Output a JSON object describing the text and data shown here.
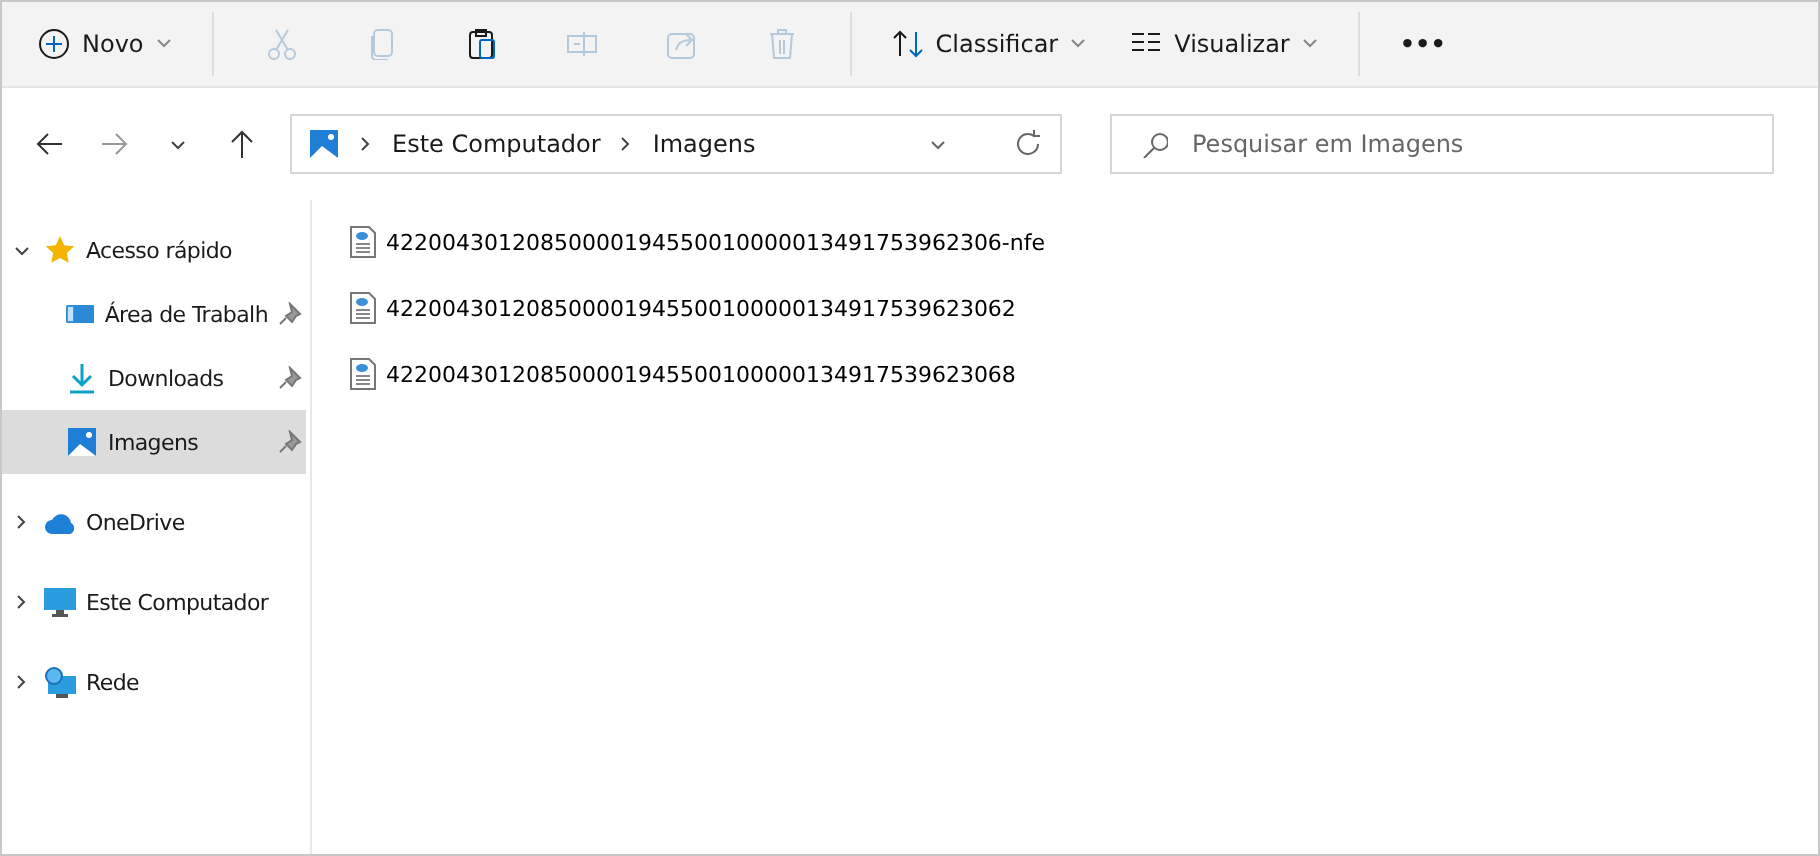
{
  "toolbar": {
    "new": {
      "label": "Novo"
    },
    "actions": [
      {
        "kind": "cut",
        "disabled": true
      },
      {
        "kind": "copy",
        "disabled": true
      },
      {
        "kind": "paste",
        "disabled": false
      },
      {
        "kind": "rename",
        "disabled": true
      },
      {
        "kind": "share",
        "disabled": true
      },
      {
        "kind": "delete",
        "disabled": true
      }
    ],
    "sort": {
      "label": "Classificar"
    },
    "view": {
      "label": "Visualizar"
    },
    "more": {
      "label": "•••"
    }
  },
  "nav": {
    "back_disabled": false,
    "forward_disabled": true
  },
  "address": {
    "crumbs": [
      "Este Computador",
      "Imagens"
    ]
  },
  "search": {
    "placeholder": "Pesquisar em Imagens"
  },
  "sidebar": {
    "items": [
      {
        "label": "Acesso rápido",
        "kind": "star",
        "expanded": true,
        "selected": false,
        "children": [
          {
            "label": "Área de Trabalh",
            "kind": "desktop",
            "pinned": true,
            "selected": false
          },
          {
            "label": "Downloads",
            "kind": "download",
            "pinned": true,
            "selected": false
          },
          {
            "label": "Imagens",
            "kind": "pictures",
            "pinned": true,
            "selected": true
          }
        ]
      },
      {
        "label": "OneDrive",
        "kind": "cloud",
        "expanded": false,
        "selected": false
      },
      {
        "label": "Este Computador",
        "kind": "monitor",
        "expanded": false,
        "selected": false
      },
      {
        "label": "Rede",
        "kind": "network",
        "expanded": false,
        "selected": false
      }
    ]
  },
  "files": [
    {
      "name": "42200430120850000194550010000013491753962306-nfe"
    },
    {
      "name": "422004301208500001945500100000134917539623062"
    },
    {
      "name": "422004301208500001945500100000134917539623068"
    }
  ]
}
